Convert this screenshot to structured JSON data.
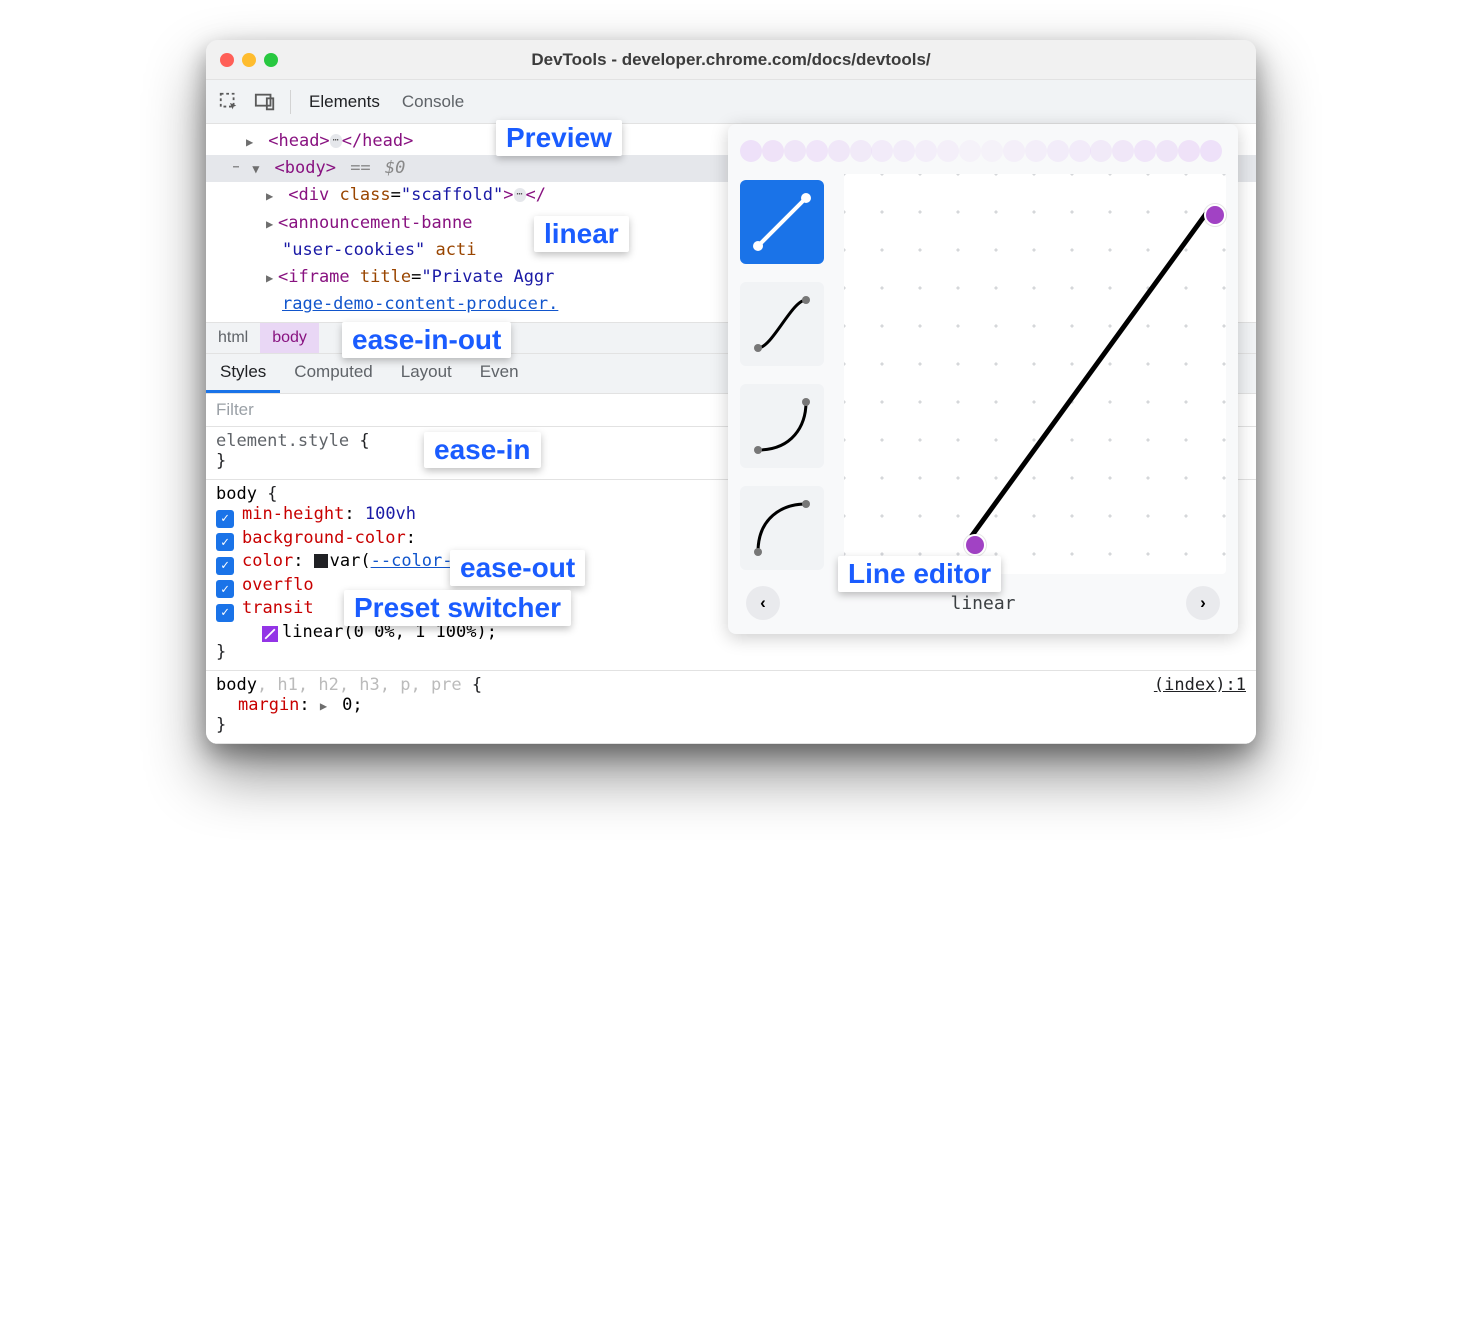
{
  "window": {
    "title": "DevTools - developer.chrome.com/docs/devtools/"
  },
  "main_tabs": {
    "elements": "Elements",
    "console": "Console"
  },
  "dom": {
    "head_open": "<head>",
    "head_close": "</head>",
    "body_open": "<body>",
    "body_eq": " == ",
    "body_dollar": "$0",
    "div_text": "<div class=\"scaffold\">",
    "ann_text": "<announcement-banne",
    "cookies_text": "\"user-cookies\" acti",
    "iframe_text": "<iframe title=\"Private Aggr",
    "iframe_link": "rage-demo-content-producer."
  },
  "breadcrumbs": [
    "html",
    "body"
  ],
  "styles_tabs": [
    "Styles",
    "Computed",
    "Layout",
    "Even"
  ],
  "filter_placeholder": "Filter",
  "rules": {
    "r0": {
      "selector": "element.style"
    },
    "r1": {
      "selector": "body",
      "min_height_k": "min-height",
      "min_height_v": "100vh",
      "bg_k": "background-color",
      "color_k": "color",
      "color_v": "var(",
      "color_var": "--color-text",
      "color_end": ")",
      "overflow_k": "overflo",
      "transit_k": "transit",
      "ease_v": "linear(0 0%, 1 100%)"
    },
    "r2": {
      "selector_active": "body",
      "selector_rest": ", h1, h2, h3, p, pre",
      "src": "(index):1",
      "margin_k": "margin",
      "margin_v": "0"
    }
  },
  "easing": {
    "thumbs": [
      "linear",
      "ease-in-out",
      "ease-in",
      "ease-out"
    ],
    "nav_label": "linear"
  },
  "annotations": {
    "preview": "Preview",
    "linear": "linear",
    "ease_in_out": "ease-in-out",
    "ease_in": "ease-in",
    "ease_out": "ease-out",
    "preset_switcher": "Preset switcher",
    "line_editor": "Line editor"
  }
}
